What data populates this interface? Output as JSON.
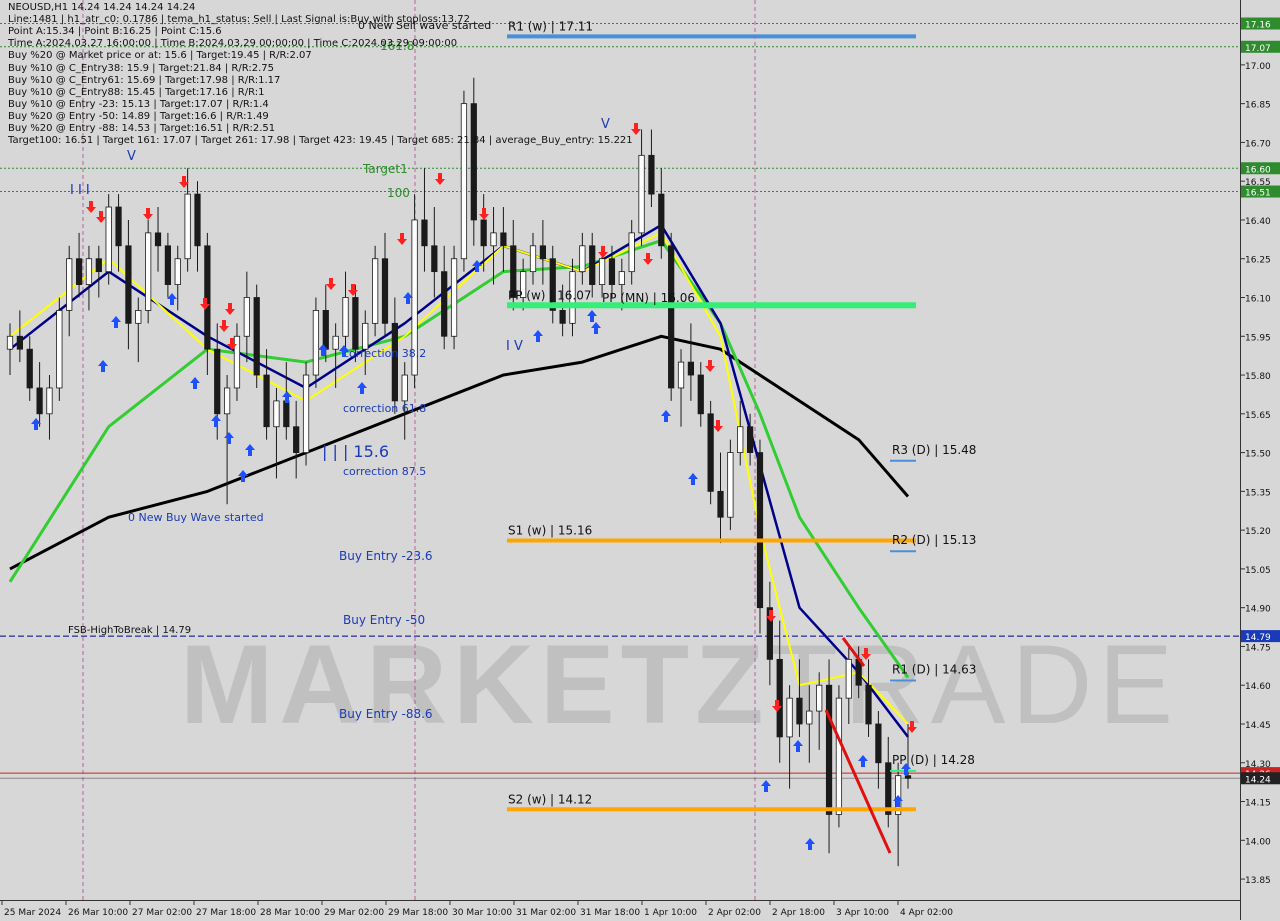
{
  "header_lines": [
    "NEOUSD,H1  14.24 14.24 14.24 14.24",
    "Line:1481 | h1_atr_c0: 0.1786 | tema_h1_status: Sell | Last Signal is:Buy with stoploss:13.72",
    "Point A:15.34 | Point B:16.25 | Point C:15.6",
    "Time A:2024.03.27 16:00:00 | Time B:2024.03.29 00:00:00 | Time C:2024.03.29 09:00:00",
    "Buy %20 @ Market price or at: 15.6 | Target:19.45 | R/R:2.07",
    "Buy %10 @ C_Entry38: 15.9 | Target:21.84 | R/R:2.75",
    "Buy %10 @ C_Entry61: 15.69 | Target:17.98 | R/R:1.17",
    "Buy %10 @ C_Entry88: 15.45 | Target:17.16 | R/R:1",
    "Buy %10 @ Entry -23: 15.13 | Target:17.07 | R/R:1.4",
    "Buy %20 @ Entry -50: 14.89 | Target:16.6 | R/R:1.49",
    "Buy %20 @ Entry -88: 14.53 | Target:16.51 | R/R:2.51",
    "Target100: 16.51 | Target 161: 17.07 | Target 261: 17.98 | Target 423: 19.45 | Target 685: 21.84 | average_Buy_entry: 15.221"
  ],
  "watermark": {
    "bold": "MARKETZ",
    "thin": "TRADE"
  },
  "colors": {
    "background": "#d7d7d7",
    "bull": "#1a1a1a",
    "bear": "#1a1a1a",
    "ema_yellow": "#ffff00",
    "ema_navy": "#00008b",
    "ema_green": "#32cd32",
    "ma_black": "#000000",
    "resistance": "#4a90d9",
    "support": "#ffa500",
    "pivot": "#33ee77",
    "buy_arrow": "#1e50ff",
    "sell_arrow": "#ff2020",
    "fsb": "#00008b",
    "target_green": "#2e8b2e",
    "current_price": "#cc2222"
  },
  "price_axis": {
    "ticks": [
      "17.00",
      "16.85",
      "16.70",
      "16.55",
      "16.40",
      "16.25",
      "16.10",
      "15.95",
      "15.80",
      "15.65",
      "15.50",
      "15.35",
      "15.20",
      "15.05",
      "14.90",
      "14.75",
      "14.60",
      "14.45",
      "14.30",
      "14.15",
      "14.00",
      "13.85"
    ],
    "badges": [
      {
        "label": "17.16",
        "price": 17.16,
        "color": "#2e8b2e"
      },
      {
        "label": "17.07",
        "price": 17.07,
        "color": "#2e8b2e"
      },
      {
        "label": "16.60",
        "price": 16.6,
        "color": "#2e8b2e"
      },
      {
        "label": "16.51",
        "price": 16.51,
        "color": "#2e8b2e"
      },
      {
        "label": "14.79",
        "price": 14.79,
        "color": "#1a3ab8"
      },
      {
        "label": "14.26",
        "price": 14.26,
        "color": "#cc2222"
      },
      {
        "label": "14.24",
        "price": 14.24,
        "color": "#222222"
      }
    ]
  },
  "time_axis": [
    "25 Mar 2024",
    "26 Mar 10:00",
    "27 Mar 02:00",
    "27 Mar 18:00",
    "28 Mar 10:00",
    "29 Mar 02:00",
    "29 Mar 18:00",
    "30 Mar 10:00",
    "31 Mar 02:00",
    "31 Mar 18:00",
    "1 Apr 10:00",
    "2 Apr 02:00",
    "2 Apr 18:00",
    "3 Apr 10:00",
    "4 Apr 02:00"
  ],
  "levels": [
    {
      "label": "R1 (w) | 17.11",
      "price": 17.11,
      "color": "#4a90d9"
    },
    {
      "label": "PP (w) | 16.07",
      "price": 16.07,
      "color": "#33ee77"
    },
    {
      "label": "PP (MN) | 16.06",
      "price": 16.06,
      "color": "#33ee77"
    },
    {
      "label": "S1 (w) | 15.16",
      "price": 15.16,
      "color": "#ffa500"
    },
    {
      "label": "S2 (w) | 14.12",
      "price": 14.12,
      "color": "#ffa500"
    },
    {
      "label": "R3 (D) | 15.48",
      "price": 15.48,
      "color": "#4a90d9"
    },
    {
      "label": "R2 (D) | 15.13",
      "price": 15.13,
      "color": "#4a90d9"
    },
    {
      "label": "R1 (D) | 14.63",
      "price": 14.63,
      "color": "#4a90d9"
    },
    {
      "label": "PP (D) | 14.28",
      "price": 14.28,
      "color": "#33ee77"
    }
  ],
  "annotations": {
    "fsb": "FSB-HighToBreak | 14.79",
    "buy_entry_23": "Buy Entry -23.6",
    "buy_entry_50": "Buy Entry -50",
    "buy_entry_88": "Buy Entry -88.6",
    "correction_38": "correction 38.2",
    "correction_61": "correction 61.8",
    "correction_87": "correction 87.5",
    "new_buy_wave": "0 New Buy Wave started",
    "new_sell_wave": "0 New Sell wave started",
    "target1": "Target1",
    "target_100": "100",
    "target_161": "161.8",
    "point_label": "| | | 15.6",
    "marker_v": "V",
    "marker_iv": "I V",
    "marker_iii": "I I I"
  },
  "chart_data": {
    "type": "candlestick",
    "symbol": "NEOUSD",
    "timeframe": "H1",
    "ylim": [
      13.8,
      17.22
    ],
    "grid": false,
    "ohlc": [
      [
        15.9,
        16.0,
        15.8,
        15.95
      ],
      [
        15.95,
        16.05,
        15.85,
        15.9
      ],
      [
        15.9,
        15.95,
        15.7,
        15.75
      ],
      [
        15.75,
        15.85,
        15.6,
        15.65
      ],
      [
        15.65,
        15.8,
        15.55,
        15.75
      ],
      [
        15.75,
        16.1,
        15.7,
        16.05
      ],
      [
        16.05,
        16.3,
        15.95,
        16.25
      ],
      [
        16.25,
        16.35,
        16.1,
        16.15
      ],
      [
        16.15,
        16.3,
        16.05,
        16.25
      ],
      [
        16.25,
        16.3,
        16.1,
        16.2
      ],
      [
        16.2,
        16.5,
        16.15,
        16.45
      ],
      [
        16.45,
        16.5,
        16.2,
        16.3
      ],
      [
        16.3,
        16.4,
        15.9,
        16.0
      ],
      [
        16.0,
        16.1,
        15.85,
        16.05
      ],
      [
        16.05,
        16.4,
        16.0,
        16.35
      ],
      [
        16.35,
        16.45,
        16.2,
        16.3
      ],
      [
        16.3,
        16.35,
        16.1,
        16.15
      ],
      [
        16.15,
        16.3,
        16.05,
        16.25
      ],
      [
        16.25,
        16.6,
        16.2,
        16.5
      ],
      [
        16.5,
        16.55,
        16.2,
        16.3
      ],
      [
        16.3,
        16.35,
        15.8,
        15.9
      ],
      [
        15.9,
        16.0,
        15.55,
        15.65
      ],
      [
        15.65,
        15.8,
        15.3,
        15.75
      ],
      [
        15.75,
        16.0,
        15.7,
        15.95
      ],
      [
        15.95,
        16.2,
        15.85,
        16.1
      ],
      [
        16.1,
        16.15,
        15.75,
        15.8
      ],
      [
        15.8,
        15.9,
        15.55,
        15.6
      ],
      [
        15.6,
        15.75,
        15.4,
        15.7
      ],
      [
        15.7,
        15.85,
        15.55,
        15.6
      ],
      [
        15.6,
        15.7,
        15.4,
        15.5
      ],
      [
        15.5,
        15.85,
        15.45,
        15.8
      ],
      [
        15.8,
        16.1,
        15.75,
        16.05
      ],
      [
        16.05,
        16.15,
        15.85,
        15.9
      ],
      [
        15.9,
        16.0,
        15.75,
        15.95
      ],
      [
        15.95,
        16.2,
        15.9,
        16.1
      ],
      [
        16.1,
        16.15,
        15.85,
        15.9
      ],
      [
        15.9,
        16.05,
        15.8,
        16.0
      ],
      [
        16.0,
        16.3,
        15.95,
        16.25
      ],
      [
        16.25,
        16.35,
        15.95,
        16.0
      ],
      [
        16.0,
        16.1,
        15.65,
        15.7
      ],
      [
        15.7,
        15.85,
        15.55,
        15.8
      ],
      [
        15.8,
        16.5,
        15.75,
        16.4
      ],
      [
        16.4,
        16.6,
        16.2,
        16.3
      ],
      [
        16.3,
        16.45,
        16.1,
        16.2
      ],
      [
        16.2,
        16.3,
        15.9,
        15.95
      ],
      [
        15.95,
        16.3,
        15.9,
        16.25
      ],
      [
        16.25,
        16.9,
        16.2,
        16.85
      ],
      [
        16.85,
        16.95,
        16.3,
        16.4
      ],
      [
        16.4,
        16.5,
        16.2,
        16.3
      ],
      [
        16.3,
        16.45,
        16.15,
        16.35
      ],
      [
        16.35,
        16.45,
        16.2,
        16.3
      ],
      [
        16.3,
        16.4,
        16.05,
        16.1
      ],
      [
        16.1,
        16.25,
        16.05,
        16.2
      ],
      [
        16.2,
        16.35,
        16.15,
        16.3
      ],
      [
        16.3,
        16.4,
        16.15,
        16.25
      ],
      [
        16.25,
        16.3,
        16.0,
        16.05
      ],
      [
        16.05,
        16.15,
        15.95,
        16.0
      ],
      [
        16.0,
        16.25,
        15.95,
        16.2
      ],
      [
        16.2,
        16.35,
        16.15,
        16.3
      ],
      [
        16.3,
        16.35,
        16.1,
        16.15
      ],
      [
        16.15,
        16.3,
        16.1,
        16.25
      ],
      [
        16.25,
        16.3,
        16.1,
        16.15
      ],
      [
        16.15,
        16.25,
        16.05,
        16.2
      ],
      [
        16.2,
        16.4,
        16.15,
        16.35
      ],
      [
        16.35,
        16.75,
        16.3,
        16.65
      ],
      [
        16.65,
        16.75,
        16.45,
        16.5
      ],
      [
        16.5,
        16.6,
        16.25,
        16.3
      ],
      [
        16.3,
        16.35,
        15.7,
        15.75
      ],
      [
        15.75,
        15.9,
        15.6,
        15.85
      ],
      [
        15.85,
        16.0,
        15.7,
        15.8
      ],
      [
        15.8,
        15.85,
        15.6,
        15.65
      ],
      [
        15.65,
        15.7,
        15.3,
        15.35
      ],
      [
        15.35,
        15.5,
        15.15,
        15.25
      ],
      [
        15.25,
        15.55,
        15.2,
        15.5
      ],
      [
        15.5,
        15.7,
        15.45,
        15.6
      ],
      [
        15.6,
        15.65,
        15.45,
        15.5
      ],
      [
        15.5,
        15.55,
        14.8,
        14.9
      ],
      [
        14.9,
        15.0,
        14.6,
        14.7
      ],
      [
        14.7,
        14.85,
        14.3,
        14.4
      ],
      [
        14.4,
        14.6,
        14.2,
        14.55
      ],
      [
        14.55,
        14.7,
        14.4,
        14.45
      ],
      [
        14.45,
        14.6,
        14.3,
        14.5
      ],
      [
        14.5,
        14.65,
        14.35,
        14.6
      ],
      [
        14.6,
        14.7,
        13.95,
        14.1
      ],
      [
        14.1,
        14.6,
        14.05,
        14.55
      ],
      [
        14.55,
        14.75,
        14.45,
        14.7
      ],
      [
        14.7,
        14.75,
        14.55,
        14.6
      ],
      [
        14.6,
        14.7,
        14.4,
        14.45
      ],
      [
        14.45,
        14.5,
        14.2,
        14.3
      ],
      [
        14.3,
        14.4,
        14.05,
        14.1
      ],
      [
        14.1,
        14.3,
        13.9,
        14.25
      ],
      [
        14.25,
        14.45,
        14.2,
        14.24
      ]
    ],
    "ema_yellow": [
      [
        0,
        15.95
      ],
      [
        10,
        16.25
      ],
      [
        20,
        15.9
      ],
      [
        30,
        15.7
      ],
      [
        40,
        15.95
      ],
      [
        50,
        16.3
      ],
      [
        58,
        16.2
      ],
      [
        66,
        16.35
      ],
      [
        72,
        15.95
      ],
      [
        76,
        15.2
      ],
      [
        80,
        14.6
      ],
      [
        86,
        14.65
      ],
      [
        91,
        14.45
      ]
    ],
    "ema_navy": [
      [
        0,
        15.9
      ],
      [
        10,
        16.2
      ],
      [
        20,
        15.95
      ],
      [
        30,
        15.75
      ],
      [
        40,
        16.0
      ],
      [
        50,
        16.3
      ],
      [
        58,
        16.2
      ],
      [
        66,
        16.38
      ],
      [
        72,
        16.0
      ],
      [
        76,
        15.45
      ],
      [
        80,
        14.9
      ],
      [
        86,
        14.65
      ],
      [
        91,
        14.4
      ]
    ],
    "ema_green": [
      [
        0,
        15.0
      ],
      [
        10,
        15.6
      ],
      [
        20,
        15.9
      ],
      [
        30,
        15.85
      ],
      [
        40,
        15.95
      ],
      [
        50,
        16.2
      ],
      [
        58,
        16.22
      ],
      [
        66,
        16.32
      ],
      [
        72,
        16.0
      ],
      [
        76,
        15.65
      ],
      [
        80,
        15.25
      ],
      [
        86,
        14.9
      ],
      [
        91,
        14.63
      ]
    ],
    "ma_black": [
      [
        0,
        15.05
      ],
      [
        10,
        15.25
      ],
      [
        20,
        15.35
      ],
      [
        30,
        15.5
      ],
      [
        40,
        15.65
      ],
      [
        50,
        15.8
      ],
      [
        58,
        15.85
      ],
      [
        66,
        15.95
      ],
      [
        72,
        15.9
      ],
      [
        78,
        15.75
      ],
      [
        86,
        15.55
      ],
      [
        91,
        15.33
      ]
    ]
  }
}
